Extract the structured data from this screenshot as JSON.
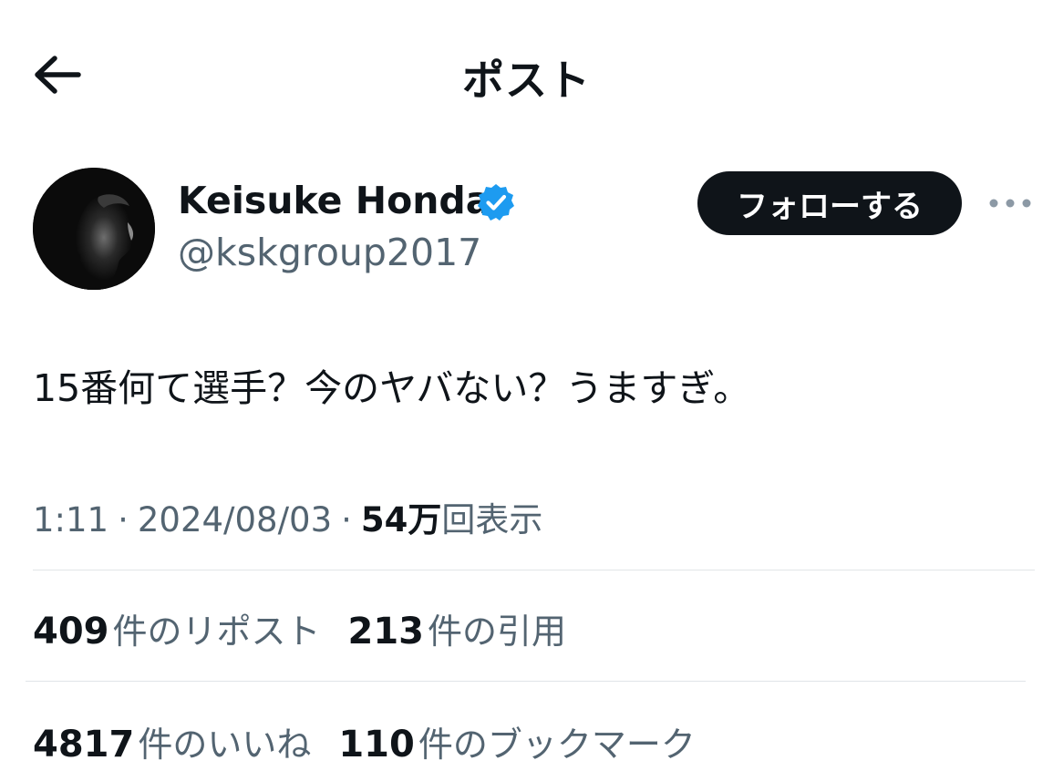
{
  "header": {
    "back_icon": "arrow-left-icon",
    "title": "ポスト"
  },
  "author": {
    "name": "Keisuke Honda",
    "verified_icon": "verified-badge-icon",
    "verified_color": "#1d9bf0",
    "handle": "@kskgroup2017",
    "follow_label": "フォローする",
    "more_icon": "more-horizontal-icon"
  },
  "post": {
    "text": "15番何て選手？今のヤバない？うますぎ。"
  },
  "meta": {
    "time": "1:11",
    "separator": "·",
    "date": "2024/08/03",
    "views_count": "54万",
    "views_label": "回表示"
  },
  "stats": {
    "reposts_count": "409",
    "reposts_label": "件のリポスト",
    "quotes_count": "213",
    "quotes_label": "件の引用",
    "likes_count": "4817",
    "likes_label": "件のいいね",
    "bookmarks_count": "110",
    "bookmarks_label": "件のブックマーク"
  },
  "colors": {
    "text_primary": "#0f1419",
    "text_secondary": "#536471",
    "divider": "#e1e5e8",
    "follow_bg": "#0f1419"
  }
}
